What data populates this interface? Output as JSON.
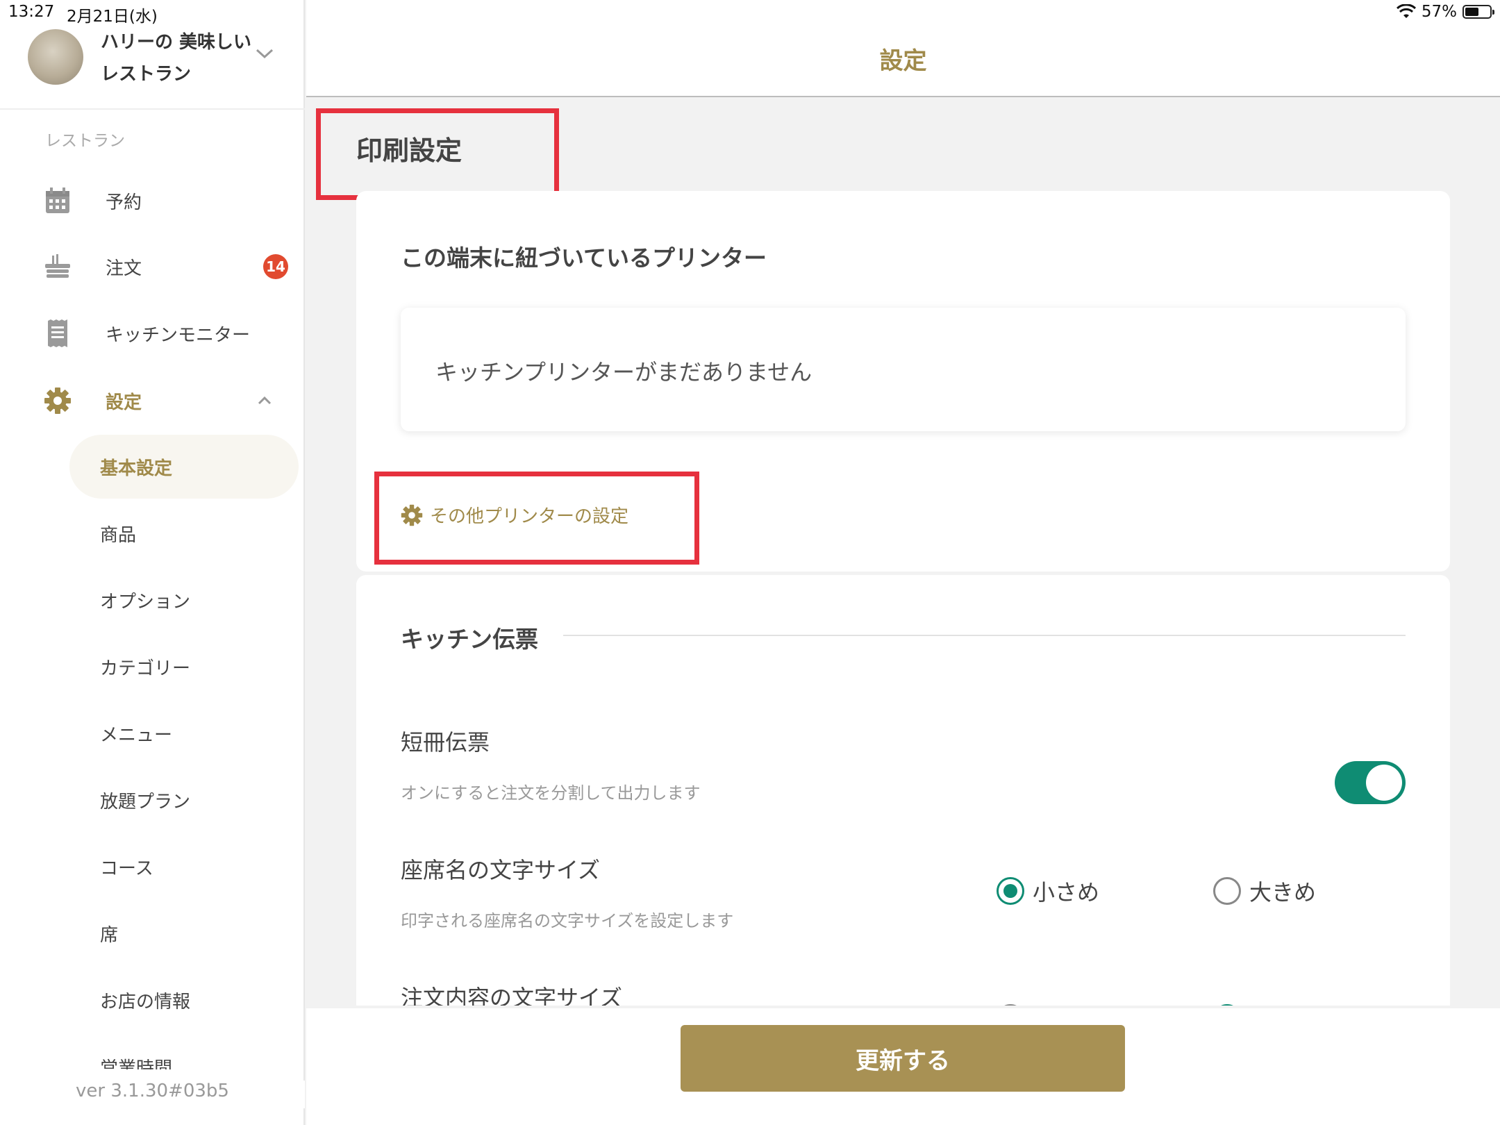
{
  "status_bar": {
    "time": "13:27",
    "date": "2月21日(水)",
    "battery_percent": "57%",
    "battery_level": 0.57
  },
  "account": {
    "name": "ハリーの 美味しいレストラン"
  },
  "sidebar": {
    "section_label": "レストラン",
    "items": [
      {
        "label": "予約",
        "icon": "calendar-icon"
      },
      {
        "label": "注文",
        "icon": "order-icon",
        "badge": "14"
      },
      {
        "label": "キッチンモニター",
        "icon": "receipt-icon"
      },
      {
        "label": "設定",
        "icon": "gear-icon"
      }
    ],
    "settings_sub": [
      "基本設定",
      "商品",
      "オプション",
      "カテゴリー",
      "メニュー",
      "放題プラン",
      "コース",
      "席",
      "お店の情報",
      "営業時間"
    ],
    "version": "ver 3.1.30#03b5"
  },
  "header": {
    "title": "設定"
  },
  "main": {
    "page_heading": "印刷設定",
    "linked_printers": {
      "title": "この端末に紐づいているプリンター",
      "empty_message": "キッチンプリンターがまだありません",
      "other_settings_link": "その他プリンターの設定"
    },
    "kitchen_slip": {
      "title": "キッチン伝票",
      "tanzaku": {
        "name": "短冊伝票",
        "desc": "オンにすると注文を分割して出力します",
        "enabled": true
      },
      "seat_font": {
        "name": "座席名の文字サイズ",
        "desc": "印字される座席名の文字サイズを設定します",
        "options": [
          "小さめ",
          "大きめ"
        ],
        "selected": "小さめ"
      },
      "order_font": {
        "name": "注文内容の文字サイズ"
      }
    }
  },
  "footer": {
    "update_label": "更新する"
  },
  "colors": {
    "accent": "#a08a4a",
    "button": "#a89154",
    "toggle_on": "#0f8c73",
    "badge": "#e14a2f",
    "highlight": "#e6313e"
  }
}
